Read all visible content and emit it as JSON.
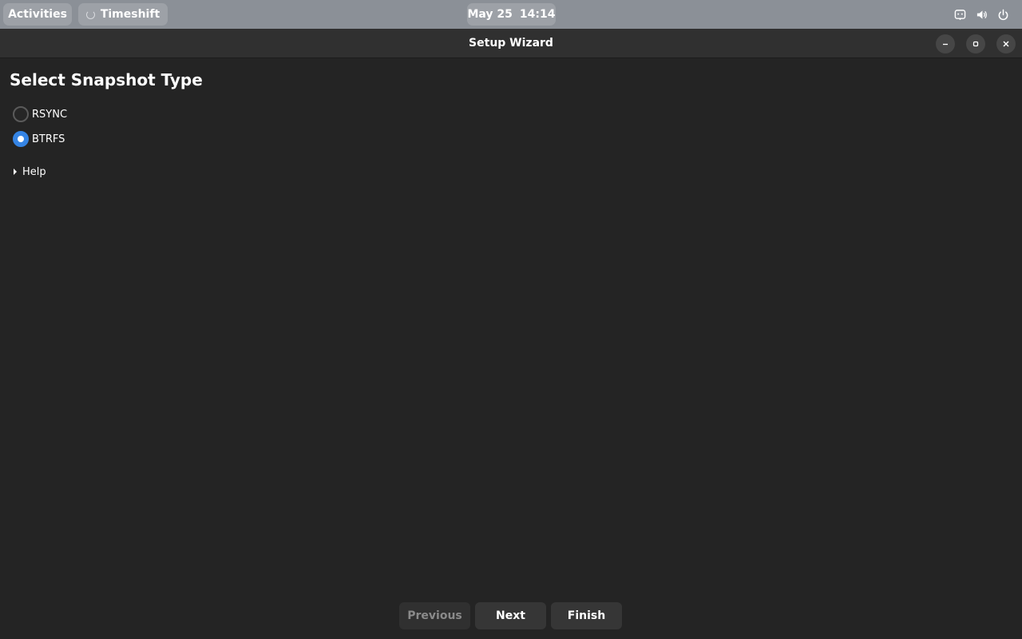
{
  "topbar": {
    "activities_label": "Activities",
    "app_label": "Timeshift",
    "clock_date": "May 25",
    "clock_time": "14:14",
    "tray_icons": [
      "accessibility-icon",
      "volume-icon",
      "power-icon"
    ]
  },
  "window": {
    "title": "Setup Wizard",
    "controls": [
      "minimize-icon",
      "maximize-icon",
      "close-icon"
    ]
  },
  "page": {
    "heading": "Select Snapshot Type",
    "options": [
      {
        "label": "RSYNC",
        "selected": false
      },
      {
        "label": "BTRFS",
        "selected": true
      }
    ],
    "help_label": "Help",
    "help_expanded": false
  },
  "buttons": {
    "previous": "Previous",
    "previous_enabled": false,
    "next": "Next",
    "finish": "Finish"
  },
  "colors": {
    "accent": "#3584e4",
    "background": "#242424",
    "topbar": "#8b9097",
    "titlebar": "#303030"
  }
}
